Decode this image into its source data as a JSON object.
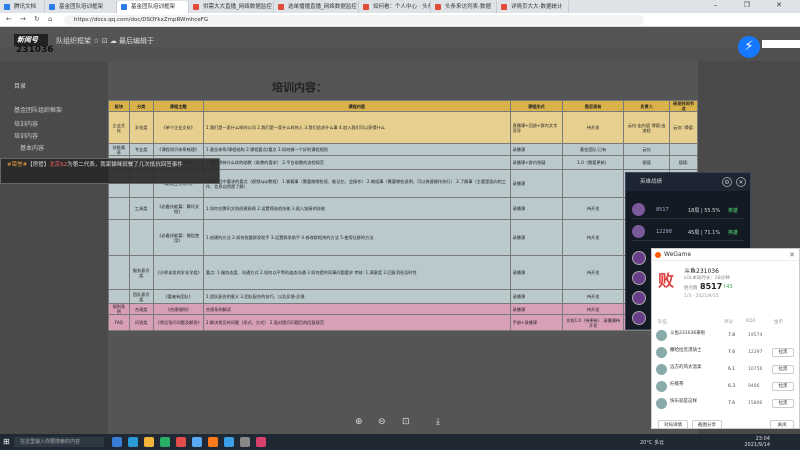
{
  "browser": {
    "tabs": [
      "腾讯文档",
      "基金团队培训框架",
      "基金团队培训框架",
      "供需大大直播_网络数据监控",
      "选单播播直播_网络数据监控",
      "如何看：个人中心 · 头条",
      "头条来访列表-数据",
      "详情页大大-数据统计"
    ],
    "url": "https://docs.qq.com/doc/DSOYkxZmpRWmhceFG",
    "window_controls": "– ❐ ✕"
  },
  "doc": {
    "logo": "新闻号",
    "room_id": "231036",
    "title": "队组织框架 ☆ ⊡ ☁ 最后编辑于",
    "side_items": [
      "目录",
      "基金团队组织框架",
      "培训内容",
      "培训内容",
      "基本内容"
    ],
    "heading": "培训内容：",
    "columns": [
      "板块",
      "分类",
      "课程主题",
      "课程内容",
      "课程形式",
      "是否现有",
      "负责人",
      "研发时间节点"
    ],
    "rows": [
      {
        "cls": "r1",
        "cells": [
          "企业文化",
          "文化类",
          "《单个企业文化》",
          "1.我们是一家什么样的公司 2.我们是一家什么样的人 3.我们追求什么事 4.加入我们可以获得什么",
          "直播课+回放+群内文字宣导",
          "待开发",
          "云仪:出内容 得德:出流程",
          "云仪: 得德:"
        ]
      },
      {
        "cls": "r2",
        "cells": [
          "技能素养",
          "专业类",
          "《课程知识体系梳理》",
          "1.基金体系/课程结构 2.课程要点/重点 3.如何做一个好的课程规划",
          "录播课",
          "基金团队:已有",
          "云仪",
          ""
        ]
      },
      {
        "cls": "r2",
        "cells": [
          "",
          "",
          "《助教培训梳理》",
          "1.我们期待什么样的助教（助教的要求） 2.平台助教的流程规范",
          "录播课+群内答疑",
          "1.0（需要更新）",
          "德德",
          "德德:"
        ]
      },
      {
        "cls": "r2",
        "cells": [
          "",
          "",
          "《助教工作技巧》",
          "带组过程中要求的要点（视频app教程） 1.掌握事（需要做哪些班、能记忆、会操作） 2.做组事（需要哪些说明、可以快速操作执行） 3.了解事（主要是面向的工作、信息自然愿了解）",
          "录播课",
          "",
          "云仪:出内容 得德:出流程",
          ""
        ]
      },
      {
        "cls": "r2",
        "cells": [
          "",
          "工具类",
          "《必备技能篇：腾讯文档》",
          "1.如何在腾讯文档创建表格 2.设置筛选的技能 3.插入链接的技能",
          "录播课",
          "待开发",
          "德德",
          "德德:"
        ]
      },
      {
        "cls": "r2",
        "cells": [
          "",
          "",
          "《必备技能篇：微信使用》",
          "1.创建的方法 2.如何批量群发助手 3.设置群发助手 4.修改群相关的方法 5.使用社群的方法",
          "录播课",
          "待开发",
          "德德",
          "德德:"
        ]
      },
      {
        "cls": "r2",
        "cells": [
          "",
          "服务意识类",
          "《沙师弟发的学长学姐》",
          "要点: 1.服务态度、沟通方式 2.如何以平等的姿态沟通 3.如何提供同事问题要求 考核: 1.满意度 2.回复消息及时性",
          "录播课",
          "待开发",
          "德德",
          "德德:"
        ]
      },
      {
        "cls": "r2",
        "cells": [
          "",
          "团队意识类",
          "《要者有团队》",
          "1.团队配合的意义 2.团队配合的技巧、以及反馈-反馈",
          "录播课",
          "待开发",
          "德德",
          "德德:"
        ]
      },
      {
        "cls": "r3",
        "cells": [
          "规则条例",
          "合规类",
          "《合规细则》",
          "合规条例解读",
          "录播课",
          "待开发",
          "合规",
          ""
        ]
      },
      {
        "cls": "r3",
        "cells": [
          "FAQ",
          "问答类",
          "《常见答问问题及解答》",
          "1.解决常见的问题（形式、方式） 2.面对提问问题后的回复规范",
          "手册+录播课",
          "文档1.0（待更新） 录播课待开发",
          "云仪:出内容 得德:出流程",
          ""
        ]
      }
    ],
    "zoom_tools": [
      "⊕",
      "⊖",
      "⊡",
      "⤓"
    ]
  },
  "chat_toast": {
    "badge": "#荣誉#",
    "tag": "【房管】",
    "user": "北京S2",
    "text": "为第二代表，我家猫咪就餐了几次抵抗回签事件"
  },
  "lol_panel": {
    "title": "英雄战绩",
    "rows": [
      {
        "num": "8517",
        "pct": "18局 | 55.5%",
        "tag": "英雄"
      },
      {
        "num": "12298",
        "pct": "45局 | 71.1%",
        "tag": "英雄"
      }
    ]
  },
  "wegame": {
    "title": "WeGame",
    "result": "败",
    "user": "斗鱼231036",
    "sub": "LOL本局时长：28分钟",
    "score_label": "胜点数",
    "score": "8517",
    "delta": "↑43",
    "date": "1/3 · 2021/9/15",
    "cols": [
      "队伍",
      "评分",
      "KDA",
      "金币"
    ],
    "players": [
      {
        "name": "斗鱼231036来啦",
        "kda": "7.8",
        "gold": "19574",
        "btn": ""
      },
      {
        "name": "撒哈拉荒漠骑士",
        "kda": "7.6",
        "gold": "12297",
        "btn": "拉黑"
      },
      {
        "name": "远方的风太温柔",
        "kda": "6.1",
        "gold": "10756",
        "btn": "拉黑"
      },
      {
        "name": "柠檬茶",
        "kda": "6.3",
        "gold": "9486",
        "btn": "拉黑"
      },
      {
        "name": "快乐就是这样",
        "kda": "7.6",
        "gold": "15806",
        "btn": "拉黑"
      }
    ],
    "footer": [
      "对局详情",
      "截图分享",
      "关闭"
    ]
  },
  "taskbar": {
    "search": "在这里输入你要搜索的内容",
    "weather": "20°C 多云",
    "time": "23:04",
    "date": "2021/9/14"
  }
}
